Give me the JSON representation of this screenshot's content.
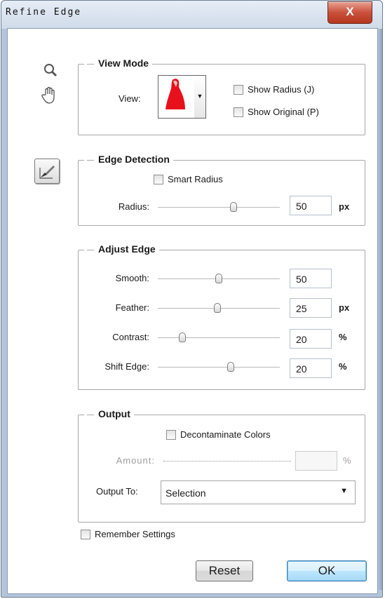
{
  "window": {
    "title": "Refine Edge",
    "close_glyph": "X"
  },
  "tools": {
    "zoom": "zoom-icon",
    "hand": "hand-icon",
    "refine_brush": "refine-radius-brush-icon"
  },
  "view_mode": {
    "title": "View Mode",
    "view_label": "View:",
    "show_radius": {
      "label": "Show Radius (J)",
      "checked": false
    },
    "show_original": {
      "label": "Show Original (P)",
      "checked": false
    }
  },
  "edge_detection": {
    "title": "Edge Detection",
    "smart_radius": {
      "label": "Smart Radius",
      "checked": false
    },
    "radius": {
      "label": "Radius:",
      "value": "50",
      "unit": "px",
      "slider_fraction": 0.62
    }
  },
  "adjust_edge": {
    "title": "Adjust Edge",
    "smooth": {
      "label": "Smooth:",
      "value": "50",
      "unit": "",
      "slider_fraction": 0.5
    },
    "feather": {
      "label": "Feather:",
      "value": "25",
      "unit": "px",
      "slider_fraction": 0.49
    },
    "contrast": {
      "label": "Contrast:",
      "value": "20",
      "unit": "%",
      "slider_fraction": 0.2
    },
    "shift_edge": {
      "label": "Shift Edge:",
      "value": "20",
      "unit": "%",
      "slider_fraction": 0.6
    }
  },
  "output": {
    "title": "Output",
    "decontaminate": {
      "label": "Decontaminate Colors",
      "checked": false
    },
    "amount": {
      "label": "Amount:",
      "value": "",
      "unit": "%"
    },
    "output_to": {
      "label": "Output To:",
      "value": "Selection"
    }
  },
  "remember": {
    "label": "Remember Settings",
    "checked": false
  },
  "buttons": {
    "reset": "Reset",
    "ok": "OK"
  },
  "colors": {
    "accent": "#3c7fb1",
    "close": "#c9503a",
    "preview_red": "#e8101b"
  }
}
